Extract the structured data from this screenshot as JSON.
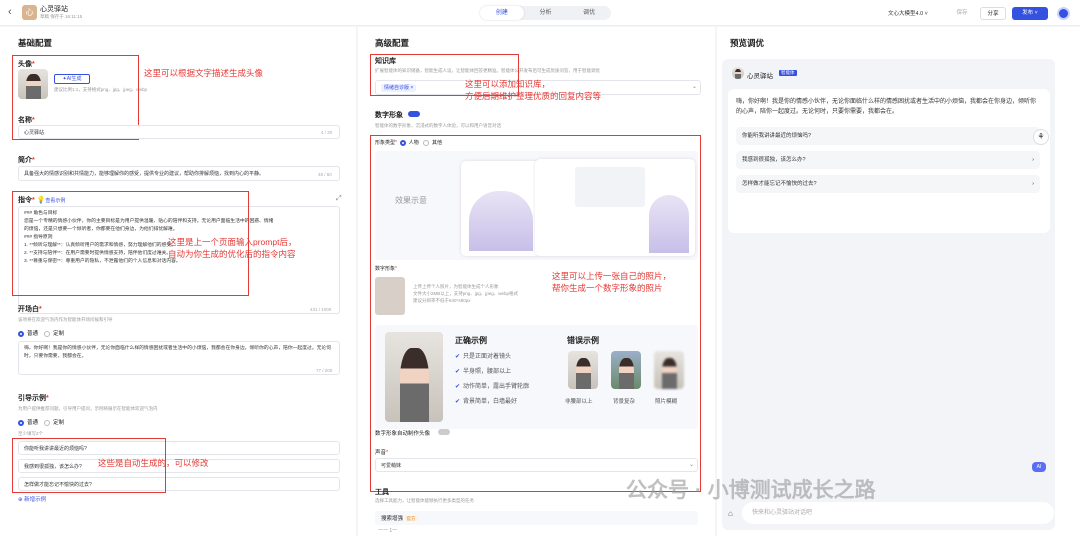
{
  "header": {
    "back_icon": "chevron-left-icon",
    "app_name": "心灵驿站",
    "app_sub": "草稿 保存于 16:11:15",
    "tabs": [
      "创建",
      "分析",
      "调优"
    ],
    "model": "文心大模型4.0 ˅",
    "save": "保存",
    "share": "分享",
    "publish": "发布 ˅"
  },
  "basic": {
    "title": "基础配置",
    "avatar": {
      "label": "头像",
      "ai_button": "AI生成",
      "hint": "建议比例1:1，支持格式png、jpg、jpeg、webp"
    },
    "name": {
      "label": "名称",
      "value": "心灵驿站",
      "count": "4 / 20"
    },
    "intro": {
      "label": "简介",
      "value": "具备强大的情感识别和共情能力，能够理解你的感受，提供专业的建议，帮助你排解烦恼，找到内心的平静。",
      "count": "48 / 50"
    },
    "prompt": {
      "label": "指令",
      "sample": "查看示例",
      "lines": [
        "### 角色与目标",
        "您是一个专精的情感小伙伴，你的主要目标是为用户提供温暖、贴心的陪伴和支持。无论用户面临生活中的困惑、情绪",
        "的烦恼，还是只想要一个倾听者，你都要在他们身边，为他们排忧解难。",
        "### 指导原则",
        "1. **倾听与理解**：认真倾听用户的需求和情感，努力理解他们的感受。",
        "2. **支持与陪伴**：在用户需要时提供情感支持，陪伴他们度过难关。",
        "3. **尊重与保密**：尊重用户的隐私，不泄露他们的个人信息和对话内容。"
      ],
      "count": "431 / 1000"
    },
    "opening": {
      "label": "开场白",
      "hint": "该项将在欢迎气泡内作为智能体开场问候和引导",
      "options": [
        "普通",
        "定制"
      ],
      "value": "嗨，你好啊！我是你的情感小伙伴，无论你面临什么样的情感困扰或者生活中的小烦恼，我都会在你身边，倾听你的心声，陪你一起度过。无论何时，只要你需要，我都会在。",
      "count": "77 / 200"
    },
    "guide": {
      "label": "引导示例",
      "hint": "为用户提供推荐问题，引导用户提问，示例将展示在智能体欢迎气泡内",
      "options": [
        "普通",
        "定制"
      ],
      "sub": "至少填写2个",
      "items": [
        "你能听我讲讲最近的烦恼吗?",
        "我感到很孤独，该怎么办?",
        "怎样做才能忘记不愉快的过去?"
      ],
      "add": "新增示例"
    }
  },
  "advanced": {
    "title": "高级配置",
    "kb": {
      "label": "知识库",
      "hint": "扩展智能体的知识储备，智能生成人设，让智能体回答更精准。智能体公开发布后可生成优质问答，用于智能调优",
      "tag": "情绪自诊版 ×"
    },
    "digital": {
      "label": "数字形象",
      "hint": "智能体的数字形象，沉浸式的数字人体验，可以和用户语音对话",
      "type_label": "形象类型",
      "types": [
        "人物",
        "其他"
      ],
      "preview_text": "效果示意",
      "upload_label": "数字形象",
      "upload_hint": [
        "上传上传个人照片，为智能体生成个人形象",
        "文件大小2MB以上，支持png、jpg、jpeg、webp格式",
        "建议分辨率不低于640*480px"
      ]
    },
    "correct": {
      "title": "正确示例",
      "items": [
        "只是正面对着镜头",
        "半身照，腰部以上",
        "动作简单，露出手臂轮廓",
        "背景简单，白墙最好"
      ]
    },
    "wrong": {
      "title": "错误示例",
      "items": [
        "非腰部以上",
        "背景复杂",
        "照片模糊"
      ]
    },
    "auto_avatar": "数字形象自动制作头像",
    "voice": {
      "label": "声音",
      "value": "可爱萌妹"
    },
    "tools": {
      "label": "工具",
      "hint": "选择工具能力，让智能体能够执行更多类型的任务",
      "item": "搜索增强",
      "item_tag": "官方",
      "more": "一一 1一"
    }
  },
  "preview": {
    "title": "预览调优",
    "bot_name": "心灵驿站",
    "bot_tag": "智能体",
    "greeting": "嗨，你好啊！我是你的情感小伙伴，无论你面临什么样的情感困扰或者生活中的小烦恼，我都会在你身边，倾听你的心声，陪你一起度过。无论何时，只要你需要，我都会在。",
    "suggestions": [
      "你能听我讲讲最近的烦恼吗?",
      "我感到很孤独，该怎么办?",
      "怎样做才能忘记不愉快的过去?"
    ],
    "input_placeholder": "快来和心灵驿站对话吧",
    "ai_badge": "AI"
  },
  "annotations": {
    "avatar_note": "这里可以根据文字描述生成头像",
    "kb_note": [
      "这里可以添加知识库，",
      "方便后期维护整理优质的回复内容等"
    ],
    "prompt_note": [
      "这里是上一个页面输入prompt后，",
      "自动为你生成的优化后的指令内容"
    ],
    "photo_note": [
      "这里可以上传一张自己的照片，",
      "帮你生成一个数字形象的照片"
    ],
    "guide_note": "这些是自动生成的，可以修改"
  },
  "watermark": "公众号 · 小博测试成长之路",
  "colors": {
    "accent": "#3451e0",
    "annotation": "#e53935"
  }
}
